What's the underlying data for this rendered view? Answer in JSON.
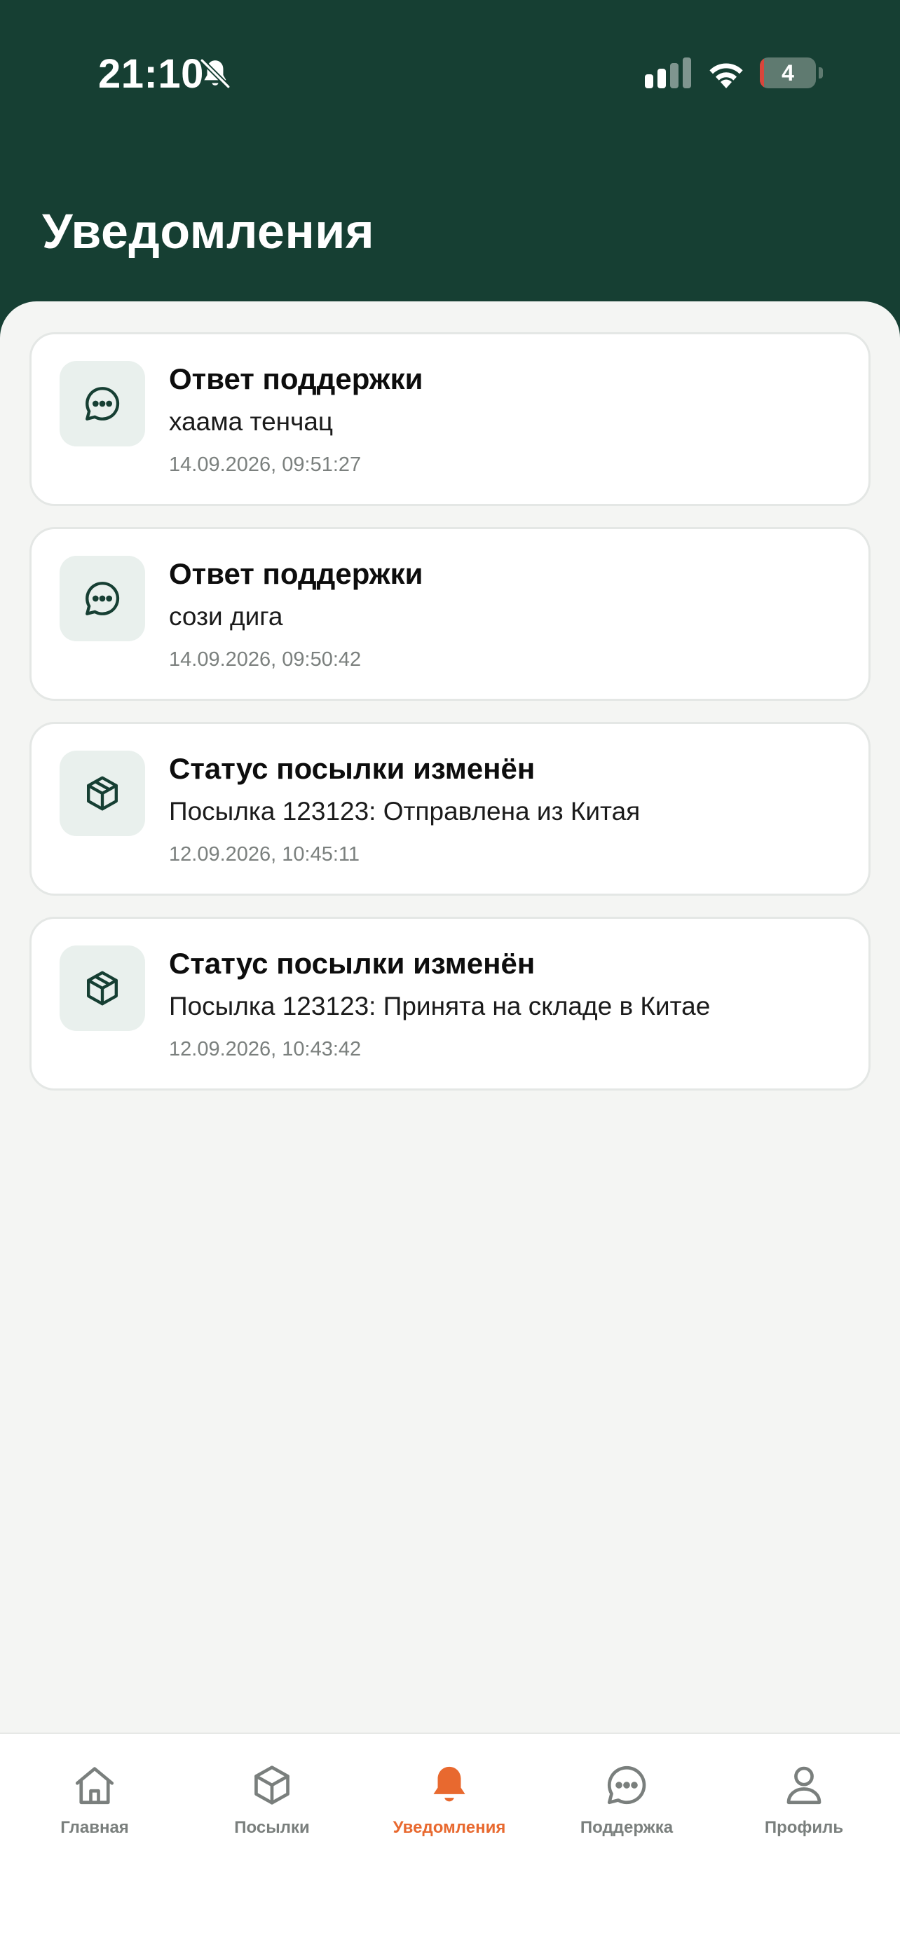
{
  "status_bar": {
    "time": "21:10",
    "battery": "4",
    "icons": [
      "bell-off-icon",
      "signal-icon",
      "wifi-icon",
      "battery-icon"
    ]
  },
  "header": {
    "title": "Уведомления",
    "background_color": "#163f33"
  },
  "notifications": [
    {
      "icon": "chat-bubble-icon",
      "title": "Ответ поддержки",
      "text": "хаама тенчац",
      "time": "14.09.2026, 09:51:27"
    },
    {
      "icon": "chat-bubble-icon",
      "title": "Ответ поддержки",
      "text": "сози дига",
      "time": "14.09.2026, 09:50:42"
    },
    {
      "icon": "package-icon",
      "title": "Статус посылки изменён",
      "text": "Посылка 123123: Отправлена из Китая",
      "time": "12.09.2026, 10:45:11"
    },
    {
      "icon": "package-icon",
      "title": "Статус посылки изменён",
      "text": "Посылка 123123: Принята на складе в Китае",
      "time": "12.09.2026, 10:43:42"
    }
  ],
  "tabbar": {
    "active_color": "#e8692f",
    "inactive_color": "#7a7f7d",
    "items": [
      {
        "label": "Главная",
        "icon": "home-icon",
        "active": false
      },
      {
        "label": "Посылки",
        "icon": "package-icon",
        "active": false
      },
      {
        "label": "Уведомления",
        "icon": "bell-icon",
        "active": true
      },
      {
        "label": "Поддержка",
        "icon": "chat-bubble-icon",
        "active": false
      },
      {
        "label": "Профиль",
        "icon": "user-icon",
        "active": false
      }
    ]
  }
}
